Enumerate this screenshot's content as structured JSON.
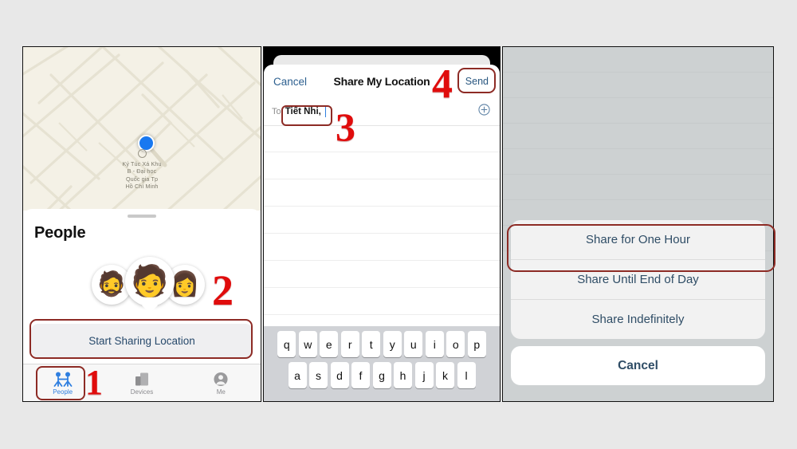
{
  "page": {
    "background": "#e8e8e8",
    "accent_blue": "#2f7fe0",
    "annotation_red": "#e00c0c",
    "highlight_outline": "#8d2b25"
  },
  "panel1": {
    "name": "find-my-people",
    "map": {
      "poi_label": "Ký Túc Xá Khu\nB - Đại học\nQuốc gia Tp\nHồ Chí Minh",
      "user_dot": "current-location-dot",
      "background": "#f4f1e6"
    },
    "sheet_title": "People",
    "avatars": [
      "🧔",
      "🧑",
      "👩"
    ],
    "share_button": "Start Sharing Location",
    "tabs": [
      {
        "label": "People",
        "icon": "people-icon",
        "active": true
      },
      {
        "label": "Devices",
        "icon": "devices-icon",
        "active": false
      },
      {
        "label": "Me",
        "icon": "person-circle-icon",
        "active": false
      }
    ]
  },
  "panel2": {
    "name": "share-my-location-compose",
    "nav": {
      "cancel": "Cancel",
      "title": "Share My Location",
      "send": "Send"
    },
    "to_label": "To:",
    "to_value": "Tiết Nhi,",
    "add_contact_icon": "plus-circle-icon",
    "keyboard": {
      "row1": [
        "q",
        "w",
        "e",
        "r",
        "t",
        "y",
        "u",
        "i",
        "o",
        "p"
      ],
      "row2": [
        "a",
        "s",
        "d",
        "f",
        "g",
        "h",
        "j",
        "k",
        "l"
      ]
    }
  },
  "panel3": {
    "name": "share-duration-action-sheet",
    "options": [
      "Share for One Hour",
      "Share Until End of Day",
      "Share Indefinitely"
    ],
    "cancel": "Cancel"
  },
  "markers": {
    "m1": "1",
    "m2": "2",
    "m3": "3",
    "m4": "4"
  }
}
